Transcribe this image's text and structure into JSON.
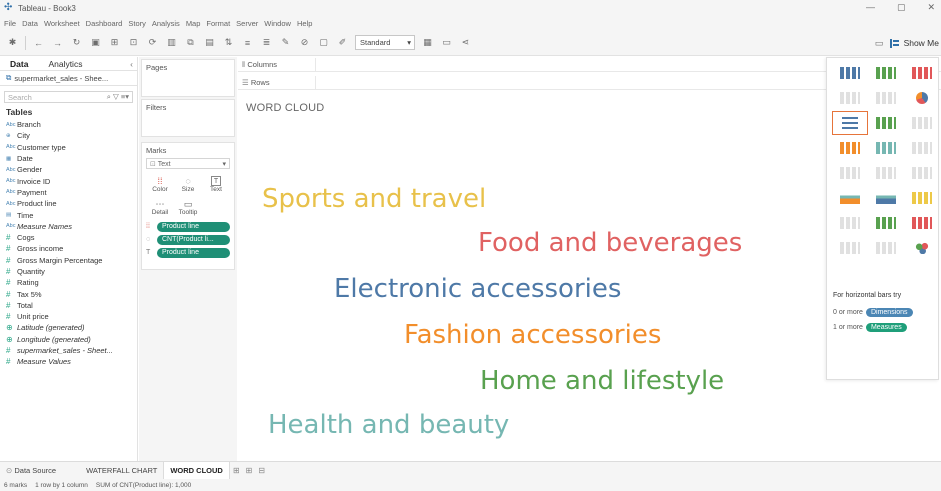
{
  "window": {
    "title": "Tableau - Book3",
    "controls": [
      "—",
      "▢",
      "✕"
    ]
  },
  "menu": [
    "File",
    "Data",
    "Worksheet",
    "Dashboard",
    "Story",
    "Analysis",
    "Map",
    "Format",
    "Server",
    "Window",
    "Help"
  ],
  "toolbar": {
    "fit_select": "Standard",
    "show_me_label": "Show Me"
  },
  "data_pane": {
    "tab_data": "Data",
    "tab_analytics": "Analytics",
    "source": "supermarket_sales - Shee...",
    "search_placeholder": "Search",
    "tables_heading": "Tables",
    "fields": [
      {
        "type": "Abc",
        "name": "Branch",
        "kind": "dim"
      },
      {
        "type": "⊕",
        "name": "City",
        "kind": "dim"
      },
      {
        "type": "Abc",
        "name": "Customer type",
        "kind": "dim"
      },
      {
        "type": "▦",
        "name": "Date",
        "kind": "dim"
      },
      {
        "type": "Abc",
        "name": "Gender",
        "kind": "dim"
      },
      {
        "type": "Abc",
        "name": "Invoice ID",
        "kind": "dim"
      },
      {
        "type": "Abc",
        "name": "Payment",
        "kind": "dim"
      },
      {
        "type": "Abc",
        "name": "Product line",
        "kind": "dim"
      },
      {
        "type": "▤",
        "name": "Time",
        "kind": "dim"
      },
      {
        "type": "Abc",
        "name": "Measure Names",
        "kind": "dim",
        "italic": true
      },
      {
        "type": "#",
        "name": "Cogs",
        "kind": "measure"
      },
      {
        "type": "#",
        "name": "Gross income",
        "kind": "measure"
      },
      {
        "type": "#",
        "name": "Gross Margin Percentage",
        "kind": "measure"
      },
      {
        "type": "#",
        "name": "Quantity",
        "kind": "measure"
      },
      {
        "type": "#",
        "name": "Rating",
        "kind": "measure"
      },
      {
        "type": "#",
        "name": "Tax 5%",
        "kind": "measure"
      },
      {
        "type": "#",
        "name": "Total",
        "kind": "measure"
      },
      {
        "type": "#",
        "name": "Unit price",
        "kind": "measure"
      },
      {
        "type": "⊕",
        "name": "Latitude (generated)",
        "kind": "measure",
        "italic": true
      },
      {
        "type": "⊕",
        "name": "Longitude (generated)",
        "kind": "measure",
        "italic": true
      },
      {
        "type": "#",
        "name": "supermarket_sales - Sheet...",
        "kind": "measure",
        "italic": true
      },
      {
        "type": "#",
        "name": "Measure Values",
        "kind": "measure",
        "italic": true
      }
    ]
  },
  "cards": {
    "pages": "Pages",
    "filters": "Filters",
    "marks": "Marks",
    "mark_type": "Text",
    "mark_buttons": [
      {
        "icon": "⁞⁞",
        "label": "Color"
      },
      {
        "icon": "◌",
        "label": "Size"
      },
      {
        "icon": "T",
        "label": "Text"
      },
      {
        "icon": "⋯",
        "label": "Detail"
      },
      {
        "icon": "▭",
        "label": "Tooltip"
      }
    ],
    "mark_pills": [
      {
        "icon": "⁞⁞",
        "label": "Product line"
      },
      {
        "icon": "◌",
        "label": "CNT(Product li..."
      },
      {
        "icon": "T",
        "label": "Product line"
      }
    ]
  },
  "shelves": {
    "columns": "Columns",
    "rows": "Rows"
  },
  "view": {
    "title": "WORD CLOUD",
    "words": [
      {
        "text": "Sports and travel",
        "color": "#e8c14a"
      },
      {
        "text": "Food and beverages",
        "color": "#e06262"
      },
      {
        "text": "Electronic accessories",
        "color": "#4e79a7"
      },
      {
        "text": "Fashion accessories",
        "color": "#f28e2b"
      },
      {
        "text": "Home and lifestyle",
        "color": "#59a14f"
      },
      {
        "text": "Health and beauty",
        "color": "#76b7b2"
      }
    ]
  },
  "show_me": {
    "hint": "For horizontal bars try",
    "row1_prefix": "0 or more",
    "row1_chip": "Dimensions",
    "row2_prefix": "1 or more",
    "row2_chip": "Measures",
    "dimensions_color": "#4b86b4",
    "measures_color": "#1f9f7a"
  },
  "sheet_tabs": {
    "data_source": "Data Source",
    "tabs": [
      "WATERFALL CHART",
      "WORD CLOUD"
    ]
  },
  "status": {
    "marks": "6 marks",
    "rows_cols": "1 row by 1 column",
    "sum": "SUM of CNT(Product line): 1,000"
  },
  "colors": {
    "accent_green": "#1f8f76",
    "accent_orange": "#e6743a"
  }
}
